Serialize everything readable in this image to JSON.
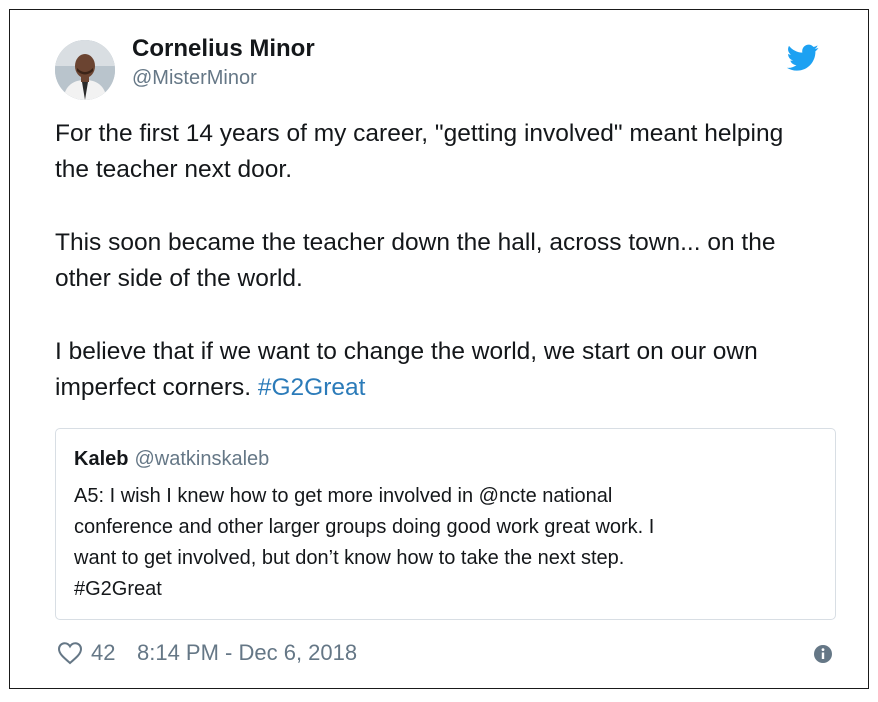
{
  "author": {
    "name": "Cornelius Minor",
    "handle": "@MisterMinor",
    "avatar_icon": "user-avatar"
  },
  "brand": {
    "logo": "twitter-bird-icon",
    "accent_color": "#1da1f2",
    "link_color": "#2b7bb9"
  },
  "tweet": {
    "paragraphs": [
      "For the first 14 years of my career, \"getting involved\" meant helping the teacher next door.",
      "This soon became the teacher down the hall, across town... on the other side of the world.",
      "I believe that if we want to change the world, we start on our own imperfect corners."
    ],
    "hashtag": "#G2Great"
  },
  "quoted_tweet": {
    "name": "Kaleb",
    "handle": "@watkinskaleb",
    "text": "A5: I wish I knew how to get more involved in @ncte national\nconference and other larger groups doing good work great work. I\nwant to get involved, but don’t know how to take the next step.\n#G2Great"
  },
  "footer": {
    "like_icon": "heart-icon",
    "likes": "42",
    "timestamp": "8:14 PM - Dec 6, 2018",
    "info_icon": "info-icon"
  }
}
